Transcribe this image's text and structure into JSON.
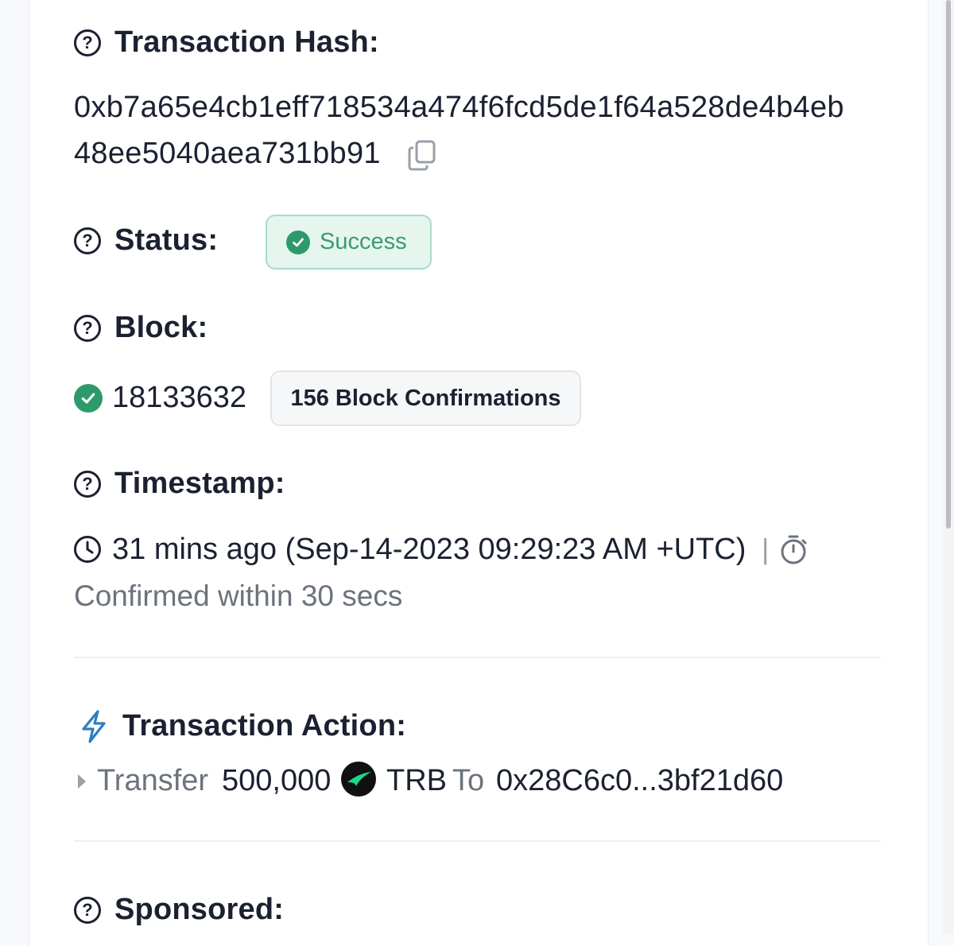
{
  "transaction_hash": {
    "label": "Transaction Hash:",
    "line1": "0xb7a65e4cb1eff718534a474f6fcd5de1f64a528de4b4eb",
    "line2": "48ee5040aea731bb91"
  },
  "status": {
    "label": "Status:",
    "value": "Success"
  },
  "block": {
    "label": "Block:",
    "number": "18133632",
    "confirmations": "156 Block Confirmations"
  },
  "timestamp": {
    "label": "Timestamp:",
    "value": "31 mins ago (Sep-14-2023 09:29:23 AM +UTC)",
    "separator": "|",
    "confirmed": "Confirmed within 30 secs"
  },
  "transaction_action": {
    "label": "Transaction Action:",
    "verb": "Transfer",
    "amount": "500,000",
    "token": "TRB",
    "to_word": "To",
    "to_address": "0x28C6c0...3bf21d60"
  },
  "sponsored": {
    "label": "Sponsored:"
  },
  "icons": {
    "question": "question-circle-icon",
    "copy": "copy-icon",
    "check": "check-circle-icon",
    "clock": "clock-icon",
    "stopwatch": "stopwatch-icon",
    "lightning": "lightning-icon",
    "caret": "caret-right-icon",
    "token": "trb-token-icon"
  },
  "colors": {
    "text": "#1b2130",
    "link": "#2f7dbd",
    "success": "#2e9a6c",
    "muted": "#6c737d"
  }
}
